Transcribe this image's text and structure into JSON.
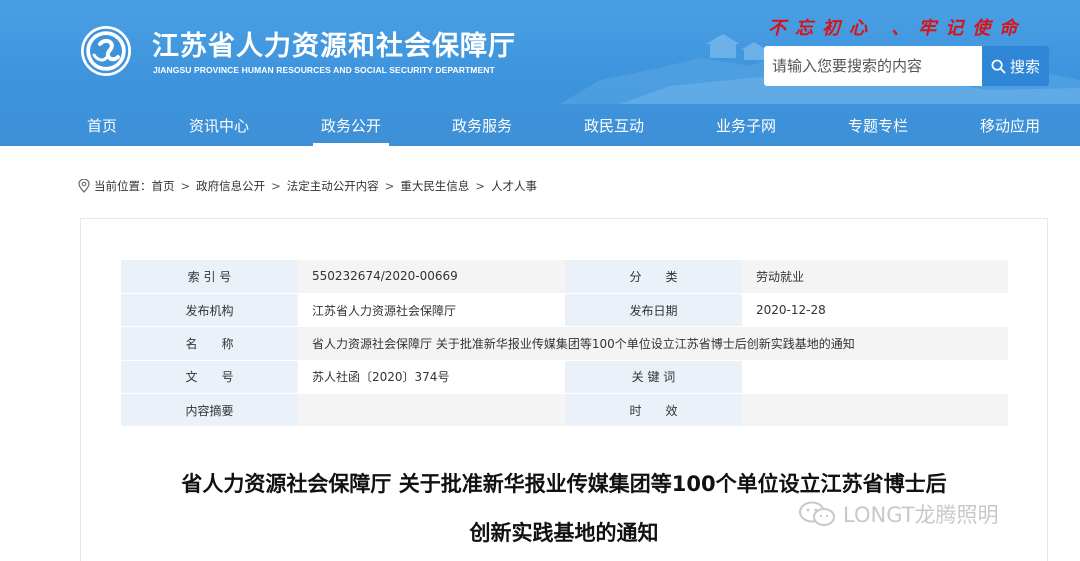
{
  "header": {
    "site_title": "江苏省人力资源和社会保障厅",
    "site_subtitle": "JIANGSU PROVINCE HUMAN RESOURCES AND SOCIAL SECURITY DEPARTMENT",
    "slogan": "不忘初心 、牢记使命",
    "search": {
      "placeholder": "请输入您要搜索的内容",
      "button_label": "搜索"
    },
    "colors": {
      "header_bg": "#3d93dc",
      "slogan": "#d7141b",
      "search_button": "#2f86d6"
    }
  },
  "nav": {
    "items": [
      {
        "label": "首页"
      },
      {
        "label": "资讯中心"
      },
      {
        "label": "政务公开",
        "active": true
      },
      {
        "label": "政务服务"
      },
      {
        "label": "政民互动"
      },
      {
        "label": "业务子网"
      },
      {
        "label": "专题专栏"
      },
      {
        "label": "移动应用"
      }
    ]
  },
  "breadcrumb": {
    "prefix": "当前位置：",
    "items": [
      "首页",
      "政府信息公开",
      "法定主动公开内容",
      "重大民生信息",
      "人才人事"
    ]
  },
  "meta_table": {
    "rows": [
      {
        "label1": "索 引 号",
        "value1": "550232674/2020-00669",
        "label2": "分　　类",
        "value2": "劳动就业"
      },
      {
        "label1": "发布机构",
        "value1": "江苏省人力资源社会保障厅",
        "label2": "发布日期",
        "value2": "2020-12-28"
      },
      {
        "label1": "名　　称",
        "value_full": "省人力资源社会保障厅 关于批准新华报业传媒集团等100个单位设立江苏省博士后创新实践基地的通知"
      },
      {
        "label1": "文　　号",
        "value1": "苏人社函〔2020〕374号",
        "label2": "关 键 词",
        "value2": ""
      },
      {
        "label1": "内容摘要",
        "value1": "",
        "label2": "时　　效",
        "value2": ""
      }
    ]
  },
  "document": {
    "title_line1": "省人力资源社会保障厅 关于批准新华报业传媒集团等100个单位设立江苏省博士后",
    "title_line2": "创新实践基地的通知"
  },
  "watermark": {
    "text": "LONGT龙腾照明"
  },
  "icons": {
    "logo": "department-logo-icon",
    "search": "search-icon",
    "location": "location-pin-icon",
    "watermark": "wechat-icon"
  }
}
